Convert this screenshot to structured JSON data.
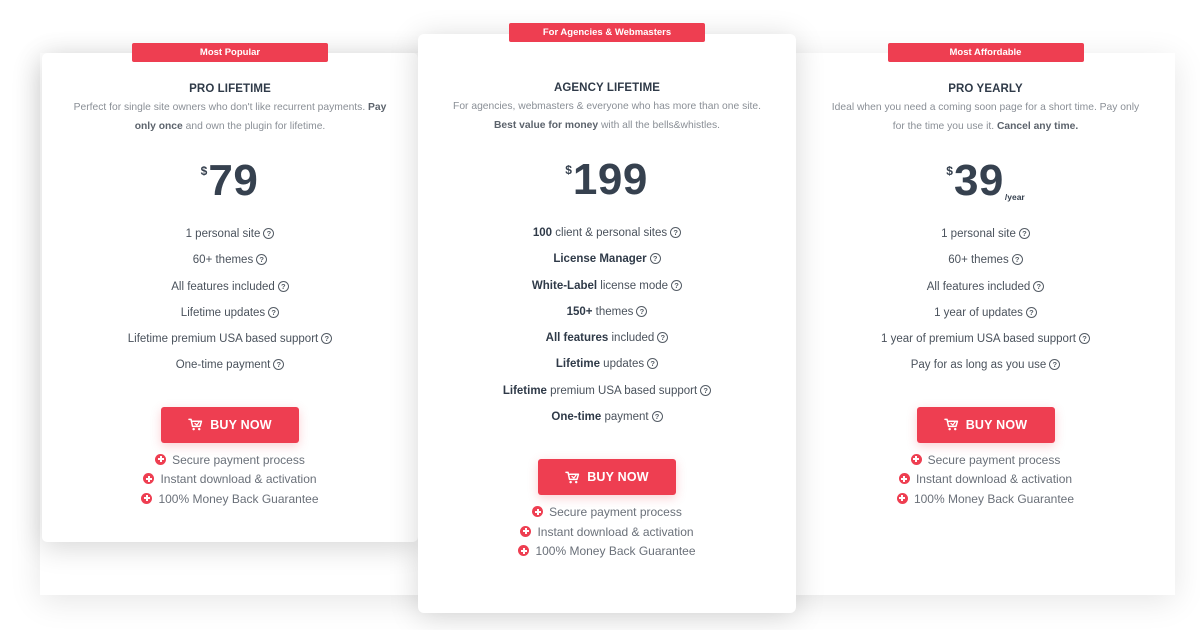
{
  "colors": {
    "accent": "#ee3e51",
    "heading": "#2f3a48",
    "muted": "#8a8f96"
  },
  "plans": [
    {
      "badge": "Most Popular",
      "name": "PRO LIFETIME",
      "desc": [
        {
          "t": "Perfect for single site owners who don't like recurrent payments. "
        },
        {
          "t": "Pay only once",
          "b": true
        },
        {
          "t": " and own the plugin for lifetime."
        }
      ],
      "currency": "$",
      "amount": "79",
      "period": "",
      "features": [
        [
          {
            "t": "1 personal site"
          }
        ],
        [
          {
            "t": "60+ themes"
          }
        ],
        [
          {
            "t": "All features included"
          }
        ],
        [
          {
            "t": "Lifetime updates"
          }
        ],
        [
          {
            "t": "Lifetime premium USA based support"
          }
        ],
        [
          {
            "t": "One-time payment"
          }
        ]
      ],
      "button": "BUY NOW",
      "guarantees": [
        "Secure payment process",
        "Instant download & activation",
        "100% Money Back Guarantee"
      ]
    },
    {
      "badge": "For Agencies & Webmasters",
      "name": "AGENCY LIFETIME",
      "desc": [
        {
          "t": "For agencies, webmasters & everyone who has more than one site. "
        },
        {
          "t": "Best value for money",
          "b": true
        },
        {
          "t": " with all the bells&whistles."
        }
      ],
      "currency": "$",
      "amount": "199",
      "period": "",
      "features": [
        [
          {
            "t": "100",
            "b": true
          },
          {
            "t": " client & personal sites"
          }
        ],
        [
          {
            "t": "License Manager",
            "b": true
          }
        ],
        [
          {
            "t": "White-Label",
            "b": true
          },
          {
            "t": " license mode"
          }
        ],
        [
          {
            "t": "150+",
            "b": true
          },
          {
            "t": " themes"
          }
        ],
        [
          {
            "t": "All features",
            "b": true
          },
          {
            "t": " included"
          }
        ],
        [
          {
            "t": "Lifetime",
            "b": true
          },
          {
            "t": " updates"
          }
        ],
        [
          {
            "t": "Lifetime",
            "b": true
          },
          {
            "t": " premium USA based support"
          }
        ],
        [
          {
            "t": "One-time",
            "b": true
          },
          {
            "t": " payment"
          }
        ]
      ],
      "button": "BUY NOW",
      "guarantees": [
        "Secure payment process",
        "Instant download & activation",
        "100% Money Back Guarantee"
      ]
    },
    {
      "badge": "Most Affordable",
      "name": "PRO YEARLY",
      "desc": [
        {
          "t": "Ideal when you need a coming soon page for a short time. Pay only for the time you use it. "
        },
        {
          "t": "Cancel any time.",
          "b": true
        }
      ],
      "currency": "$",
      "amount": "39",
      "period": "/year",
      "features": [
        [
          {
            "t": "1 personal site"
          }
        ],
        [
          {
            "t": "60+ themes"
          }
        ],
        [
          {
            "t": "All features included"
          }
        ],
        [
          {
            "t": "1 year of updates"
          }
        ],
        [
          {
            "t": "1 year of premium USA based support"
          }
        ],
        [
          {
            "t": "Pay for as long as you use"
          }
        ]
      ],
      "button": "BUY NOW",
      "guarantees": [
        "Secure payment process",
        "Instant download & activation",
        "100% Money Back Guarantee"
      ]
    }
  ]
}
